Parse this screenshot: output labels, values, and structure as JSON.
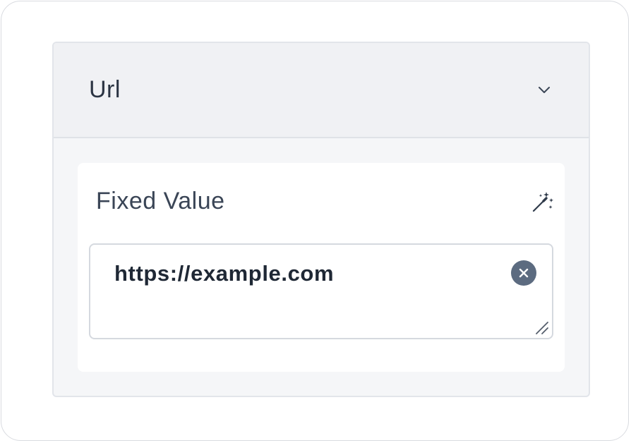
{
  "panel": {
    "title": "Url",
    "expanded": true,
    "field": {
      "label": "Fixed Value",
      "value": "https://example.com"
    }
  },
  "icons": {
    "chevron": "chevron-down-icon",
    "wand": "magic-wand-icon",
    "clear": "clear-circle-icon",
    "resize": "resize-handle-icon"
  },
  "colors": {
    "title_text": "#2b3443",
    "value_text": "#1f2835",
    "clear_button": "#5c6b80",
    "header_bg": "#f0f1f4"
  }
}
